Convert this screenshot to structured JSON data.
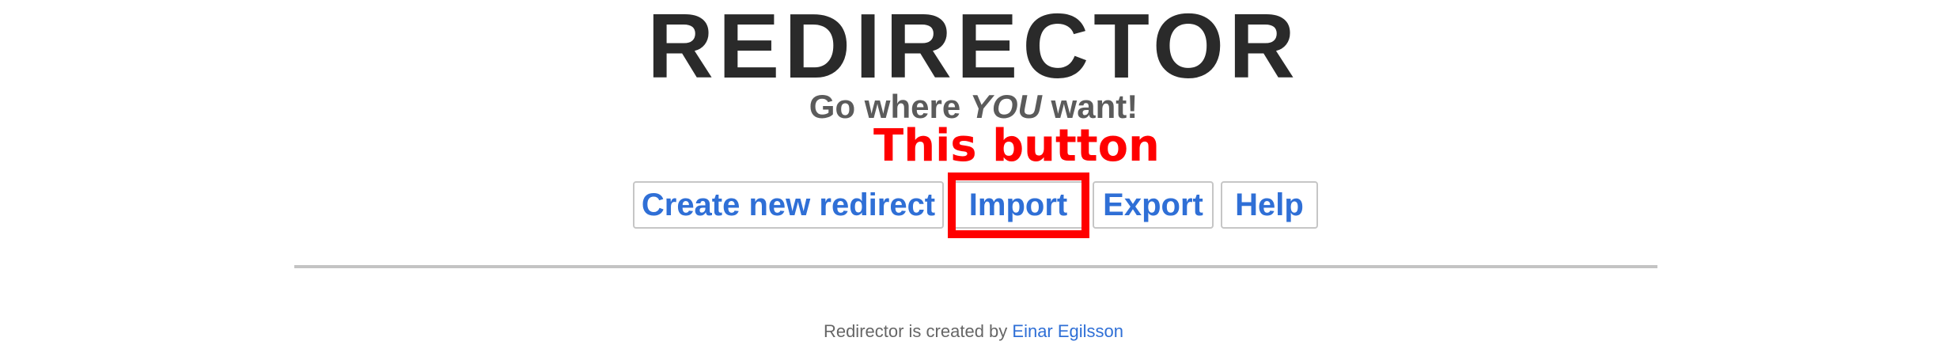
{
  "header": {
    "title": "REDIRECTOR",
    "tagline_before": "Go where ",
    "tagline_emphasis": "YOU",
    "tagline_after": " want!"
  },
  "annotation": {
    "text": "This button",
    "color": "#ff0000"
  },
  "toolbar": {
    "buttons": [
      {
        "label": "Create new redirect"
      },
      {
        "label": "Import"
      },
      {
        "label": "Export"
      },
      {
        "label": "Help"
      }
    ],
    "link_color": "#2f6fd6"
  },
  "footer": {
    "text": "Redirector is created by ",
    "author_link": "Einar Egilsson"
  }
}
